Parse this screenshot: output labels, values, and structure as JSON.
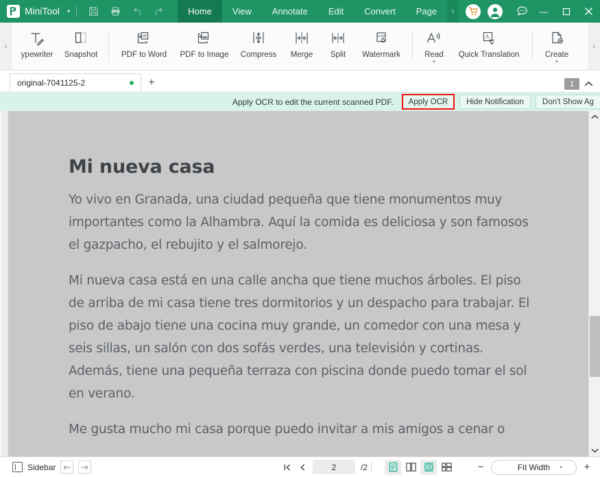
{
  "titlebar": {
    "brand": "MiniTool",
    "brand_caret": "▾",
    "quick_icons": [
      {
        "name": "save-icon",
        "glyph": "save"
      },
      {
        "name": "print-icon",
        "glyph": "print"
      },
      {
        "name": "undo-icon",
        "glyph": "undo"
      },
      {
        "name": "redo-icon",
        "glyph": "redo"
      }
    ],
    "menus": [
      {
        "label": "Home",
        "active": true
      },
      {
        "label": "View",
        "active": false
      },
      {
        "label": "Annotate",
        "active": false
      },
      {
        "label": "Edit",
        "active": false
      },
      {
        "label": "Convert",
        "active": false
      },
      {
        "label": "Page",
        "active": false
      }
    ],
    "menu_overflow": "›",
    "cart_icon": "cart-icon",
    "account_icon": "account-icon",
    "chat_icon": "chat-icon",
    "minimize": "—",
    "maximize": "▢",
    "close": "✕",
    "accent": "#1f9465",
    "active_menu_bg": "#157a51"
  },
  "ribbon": {
    "left_arrow": "‹",
    "right_arrow": "›",
    "items": [
      {
        "label": "ypewriter",
        "icon": "typewriter-icon",
        "caret": false
      },
      {
        "label": "Snapshot",
        "icon": "snapshot-icon",
        "caret": false
      },
      {
        "sep": true
      },
      {
        "label": "PDF to Word",
        "icon": "pdf-to-word-icon",
        "caret": false
      },
      {
        "label": "PDF to Image",
        "icon": "pdf-to-image-icon",
        "caret": false
      },
      {
        "label": "Compress",
        "icon": "compress-icon",
        "caret": false
      },
      {
        "label": "Merge",
        "icon": "merge-icon",
        "caret": false
      },
      {
        "label": "Split",
        "icon": "split-icon",
        "caret": false
      },
      {
        "label": "Watermark",
        "icon": "watermark-icon",
        "caret": false
      },
      {
        "sep": true
      },
      {
        "label": "Read",
        "icon": "read-aloud-icon",
        "caret": true
      },
      {
        "label": "Quick Translation",
        "icon": "quick-translation-icon",
        "caret": false
      },
      {
        "sep": true
      },
      {
        "label": "Create",
        "icon": "create-icon",
        "caret": true
      }
    ]
  },
  "tabstrip": {
    "tab_label": "original-7041125-2",
    "tab_modified_dot": true,
    "new_tab": "+",
    "page_badge": "1",
    "collapse_caret": "︿"
  },
  "notification": {
    "message": "Apply OCR to edit the current scanned PDF.",
    "buttons": [
      {
        "label": "Apply OCR",
        "highlighted": true
      },
      {
        "label": "Hide Notification",
        "highlighted": false
      },
      {
        "label": "Don't Show Ag",
        "highlighted": false,
        "clipped": true
      }
    ],
    "bg": "#daf3ea",
    "highlight_color": "#ee1111"
  },
  "document": {
    "heading": "Mi nueva casa",
    "paragraphs": [
      "Yo vivo en Granada, una ciudad pequeña que tiene monumentos muy importantes como la Alhambra. Aquí la comida es deliciosa y son famosos el gazpacho, el rebujito y el salmorejo.",
      "Mi nueva casa está en una calle ancha que tiene muchos árboles. El piso de arriba de mi casa tiene tres dormitorios y un despacho para trabajar. El piso de abajo tiene una cocina muy grande, un comedor con una mesa y seis sillas, un salón con dos sofás verdes, una televisión y cortinas. Además, tiene una pequeña terraza con piscina donde puedo tomar el sol en verano.",
      "Me gusta mucho mi casa porque puedo invitar a mis amigos a cenar o"
    ],
    "page_bg": "#c8c8c8"
  },
  "scrollbar": {
    "up": "︿",
    "down": "﹀",
    "thumb_top_pct": 60,
    "thumb_height_pct": 19
  },
  "statusbar": {
    "sidebar_label": "Sidebar",
    "prev_pane": "←",
    "next_pane": "→",
    "first_page": "⏮",
    "prev_page": "‹",
    "current_page": "2",
    "page_total": "/2",
    "view_modes": [
      {
        "name": "single-page-view",
        "selected": true
      },
      {
        "name": "two-page-view",
        "selected": false
      },
      {
        "name": "continuous-scroll-view",
        "selected": true
      },
      {
        "name": "thumbnail-grid-view",
        "selected": false
      }
    ],
    "zoom_out": "−",
    "zoom_level": "Fit Width",
    "zoom_caret": "▾",
    "zoom_in": "+"
  }
}
